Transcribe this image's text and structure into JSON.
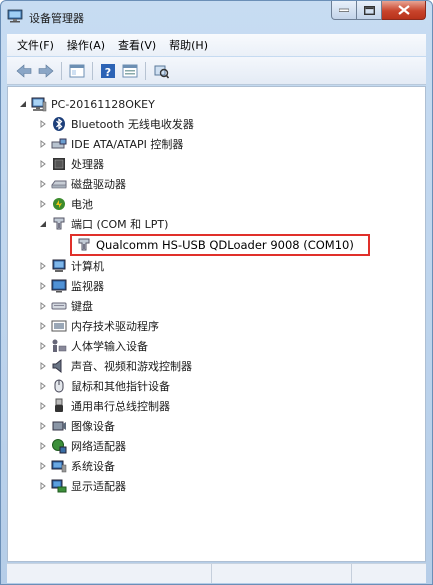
{
  "window": {
    "title": "设备管理器"
  },
  "menu": {
    "items": [
      "文件(F)",
      "操作(A)",
      "查看(V)",
      "帮助(H)"
    ]
  },
  "tree": {
    "root": "PC-20161128OKEY",
    "categories": [
      "Bluetooth 无线电收发器",
      "IDE ATA/ATAPI 控制器",
      "处理器",
      "磁盘驱动器",
      "电池",
      "端口 (COM 和 LPT)",
      "计算机",
      "监视器",
      "键盘",
      "内存技术驱动程序",
      "人体学输入设备",
      "声音、视频和游戏控制器",
      "鼠标和其他指针设备",
      "通用串行总线控制器",
      "图像设备",
      "网络适配器",
      "系统设备",
      "显示适配器"
    ],
    "port_child": "Qualcomm HS-USB QDLoader 9008 (COM10)"
  },
  "colors": {
    "highlight_border": "#e0302a",
    "close_button": "#c8442c"
  }
}
